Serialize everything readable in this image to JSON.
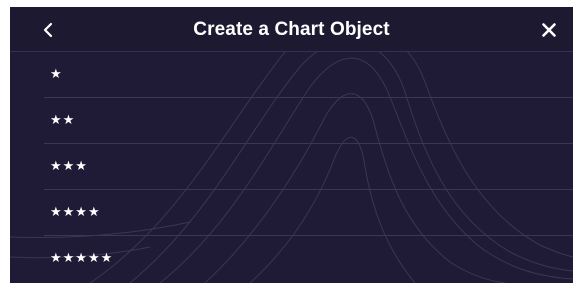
{
  "header": {
    "title": "Create a Chart Object",
    "back_icon": "chevron-left-icon",
    "close_icon": "close-icon"
  },
  "rating_options": [
    {
      "stars": "★",
      "rating": 1
    },
    {
      "stars": "★★",
      "rating": 2
    },
    {
      "stars": "★★★",
      "rating": 3
    },
    {
      "stars": "★★★★",
      "rating": 4
    },
    {
      "stars": "★★★★★",
      "rating": 5
    }
  ],
  "colors": {
    "background": "#1f1b36",
    "header": "#1c1931",
    "separator": "#3a3656",
    "text": "#ffffff"
  }
}
